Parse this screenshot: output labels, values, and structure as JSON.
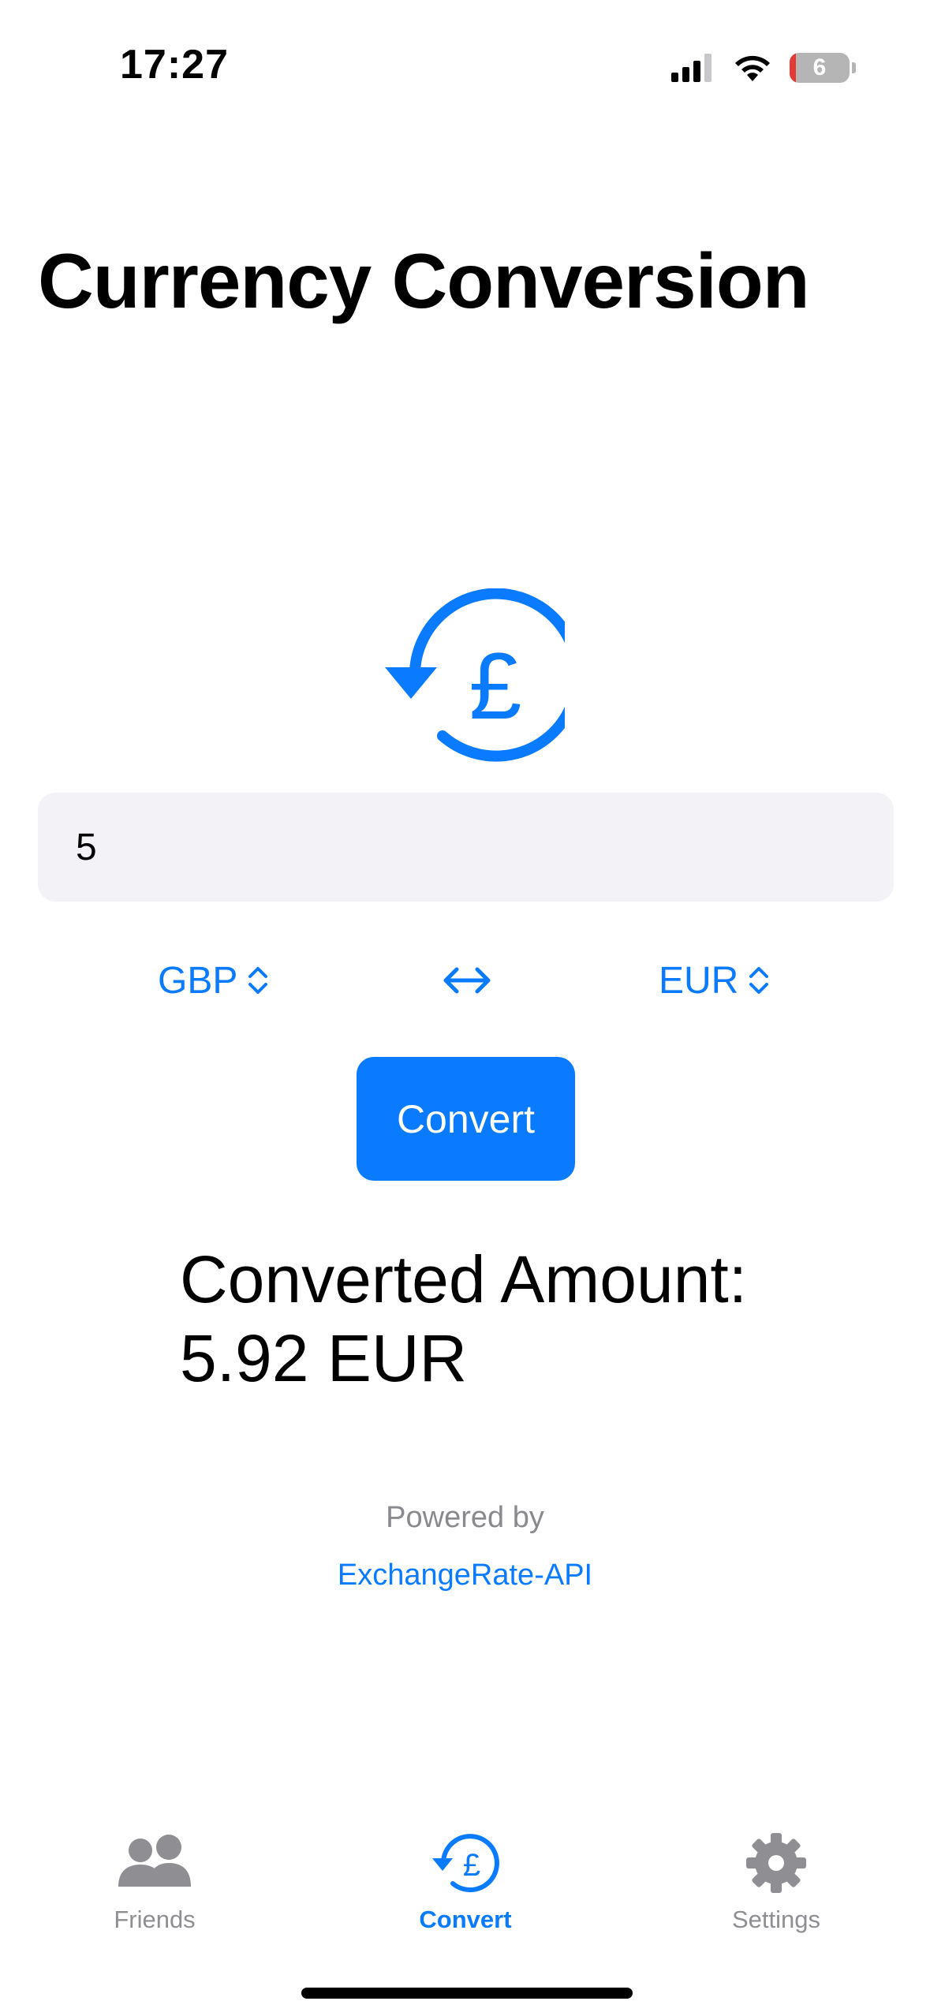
{
  "status_bar": {
    "time": "17:27",
    "battery_level": "6",
    "icons": [
      "cellular-signal-icon",
      "wifi-icon",
      "battery-icon"
    ]
  },
  "page": {
    "title": "Currency Conversion"
  },
  "hero_icon": "pound-sign-circle-arrow-icon",
  "amount_field": {
    "value": "5"
  },
  "from_currency": {
    "label": "GBP",
    "icon": "chevron-up-down-icon"
  },
  "swap": {
    "icon": "left-right-arrow-icon"
  },
  "to_currency": {
    "label": "EUR",
    "icon": "chevron-up-down-icon"
  },
  "convert_button": {
    "label": "Convert"
  },
  "result": {
    "line1": "Converted Amount:",
    "line2": "5.92 EUR"
  },
  "attribution": {
    "powered_by": "Powered by",
    "link_text": "ExchangeRate-API"
  },
  "tab_bar": {
    "tabs": [
      {
        "label": "Friends",
        "icon": "people-icon",
        "selected": false
      },
      {
        "label": "Convert",
        "icon": "pound-sign-circle-arrow-icon",
        "selected": true
      },
      {
        "label": "Settings",
        "icon": "gear-icon",
        "selected": false
      }
    ]
  },
  "colors": {
    "accent": "#0a7aff",
    "field_background": "#f2f2f7",
    "inactive_tab": "#8e8e93",
    "battery_low": "#e53935"
  }
}
